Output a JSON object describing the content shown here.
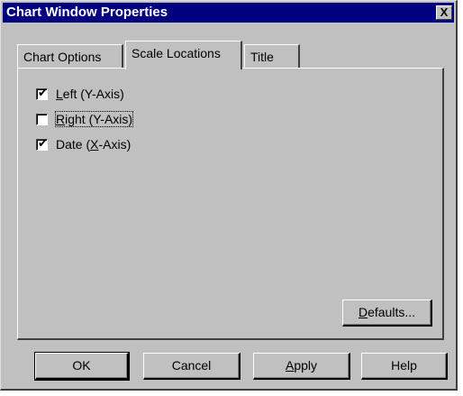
{
  "window": {
    "title": "Chart Window Properties",
    "close_label": "X"
  },
  "tabs": [
    {
      "label": "Chart Options",
      "active": false
    },
    {
      "label": "Scale Locations",
      "active": true
    },
    {
      "label": "Title",
      "active": false
    }
  ],
  "scale_locations": {
    "options": [
      {
        "mnemonic": "L",
        "label_rest": "eft (Y-Axis)",
        "checked": true
      },
      {
        "mnemonic": "R",
        "label_rest": "ight (Y-Axis)",
        "checked": false
      },
      {
        "label_prefix": "Date (",
        "mnemonic": "X",
        "label_rest": "-Axis)",
        "checked": true
      }
    ],
    "defaults_button": {
      "mnemonic": "D",
      "label_rest": "efaults..."
    }
  },
  "buttons": {
    "ok": "OK",
    "cancel": "Cancel",
    "apply_mnemonic": "A",
    "apply_rest": "pply",
    "help": "Help"
  },
  "check_mark": "✔"
}
